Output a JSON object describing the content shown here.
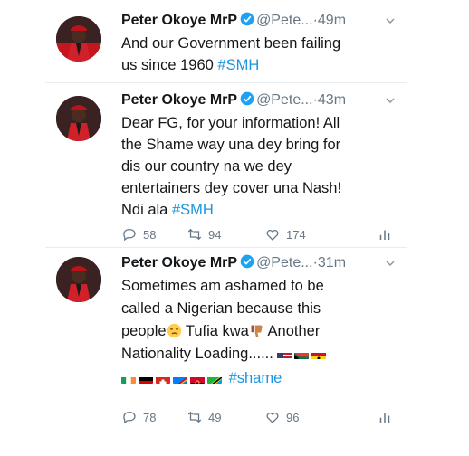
{
  "tweets": [
    {
      "name": "Peter Okoye MrP",
      "handle": "@Pete...",
      "dot": "·",
      "time": "49m",
      "text_line1": "And our Government been failing",
      "text_line2": "us since 1960",
      "hashtag": "#SMH"
    },
    {
      "name": "Peter Okoye MrP",
      "handle": "@Pete...",
      "dot": "·",
      "time": "43m",
      "lines": [
        "Dear FG, for your information! All",
        "the Shame way una dey bring  for",
        "dis our country na we dey",
        "entertainers dey cover una Nash!"
      ],
      "last_line": "Ndi ala",
      "hashtag": "#SMH",
      "replies": "58",
      "retweets": "94",
      "likes": "174"
    },
    {
      "name": "Peter Okoye MrP",
      "handle": "@Pete...",
      "dot": "·",
      "time": "31m",
      "lines": [
        "Sometimes am ashamed to be",
        "called a Nigerian because this"
      ],
      "line3_a": "people",
      "line3_b": " Tufia kwa",
      "line3_c": " Another",
      "line4": "Nationality Loading......",
      "hashtag": "#shame",
      "replies": "78",
      "retweets": "49",
      "likes": "96"
    }
  ],
  "colors": {
    "link": "#1b95e0",
    "verified": "#1da1f2",
    "muted": "#657786"
  },
  "icons": [
    "verified-badge-icon",
    "chevron-down-icon",
    "reply-icon",
    "retweet-icon",
    "like-icon",
    "analytics-icon"
  ]
}
